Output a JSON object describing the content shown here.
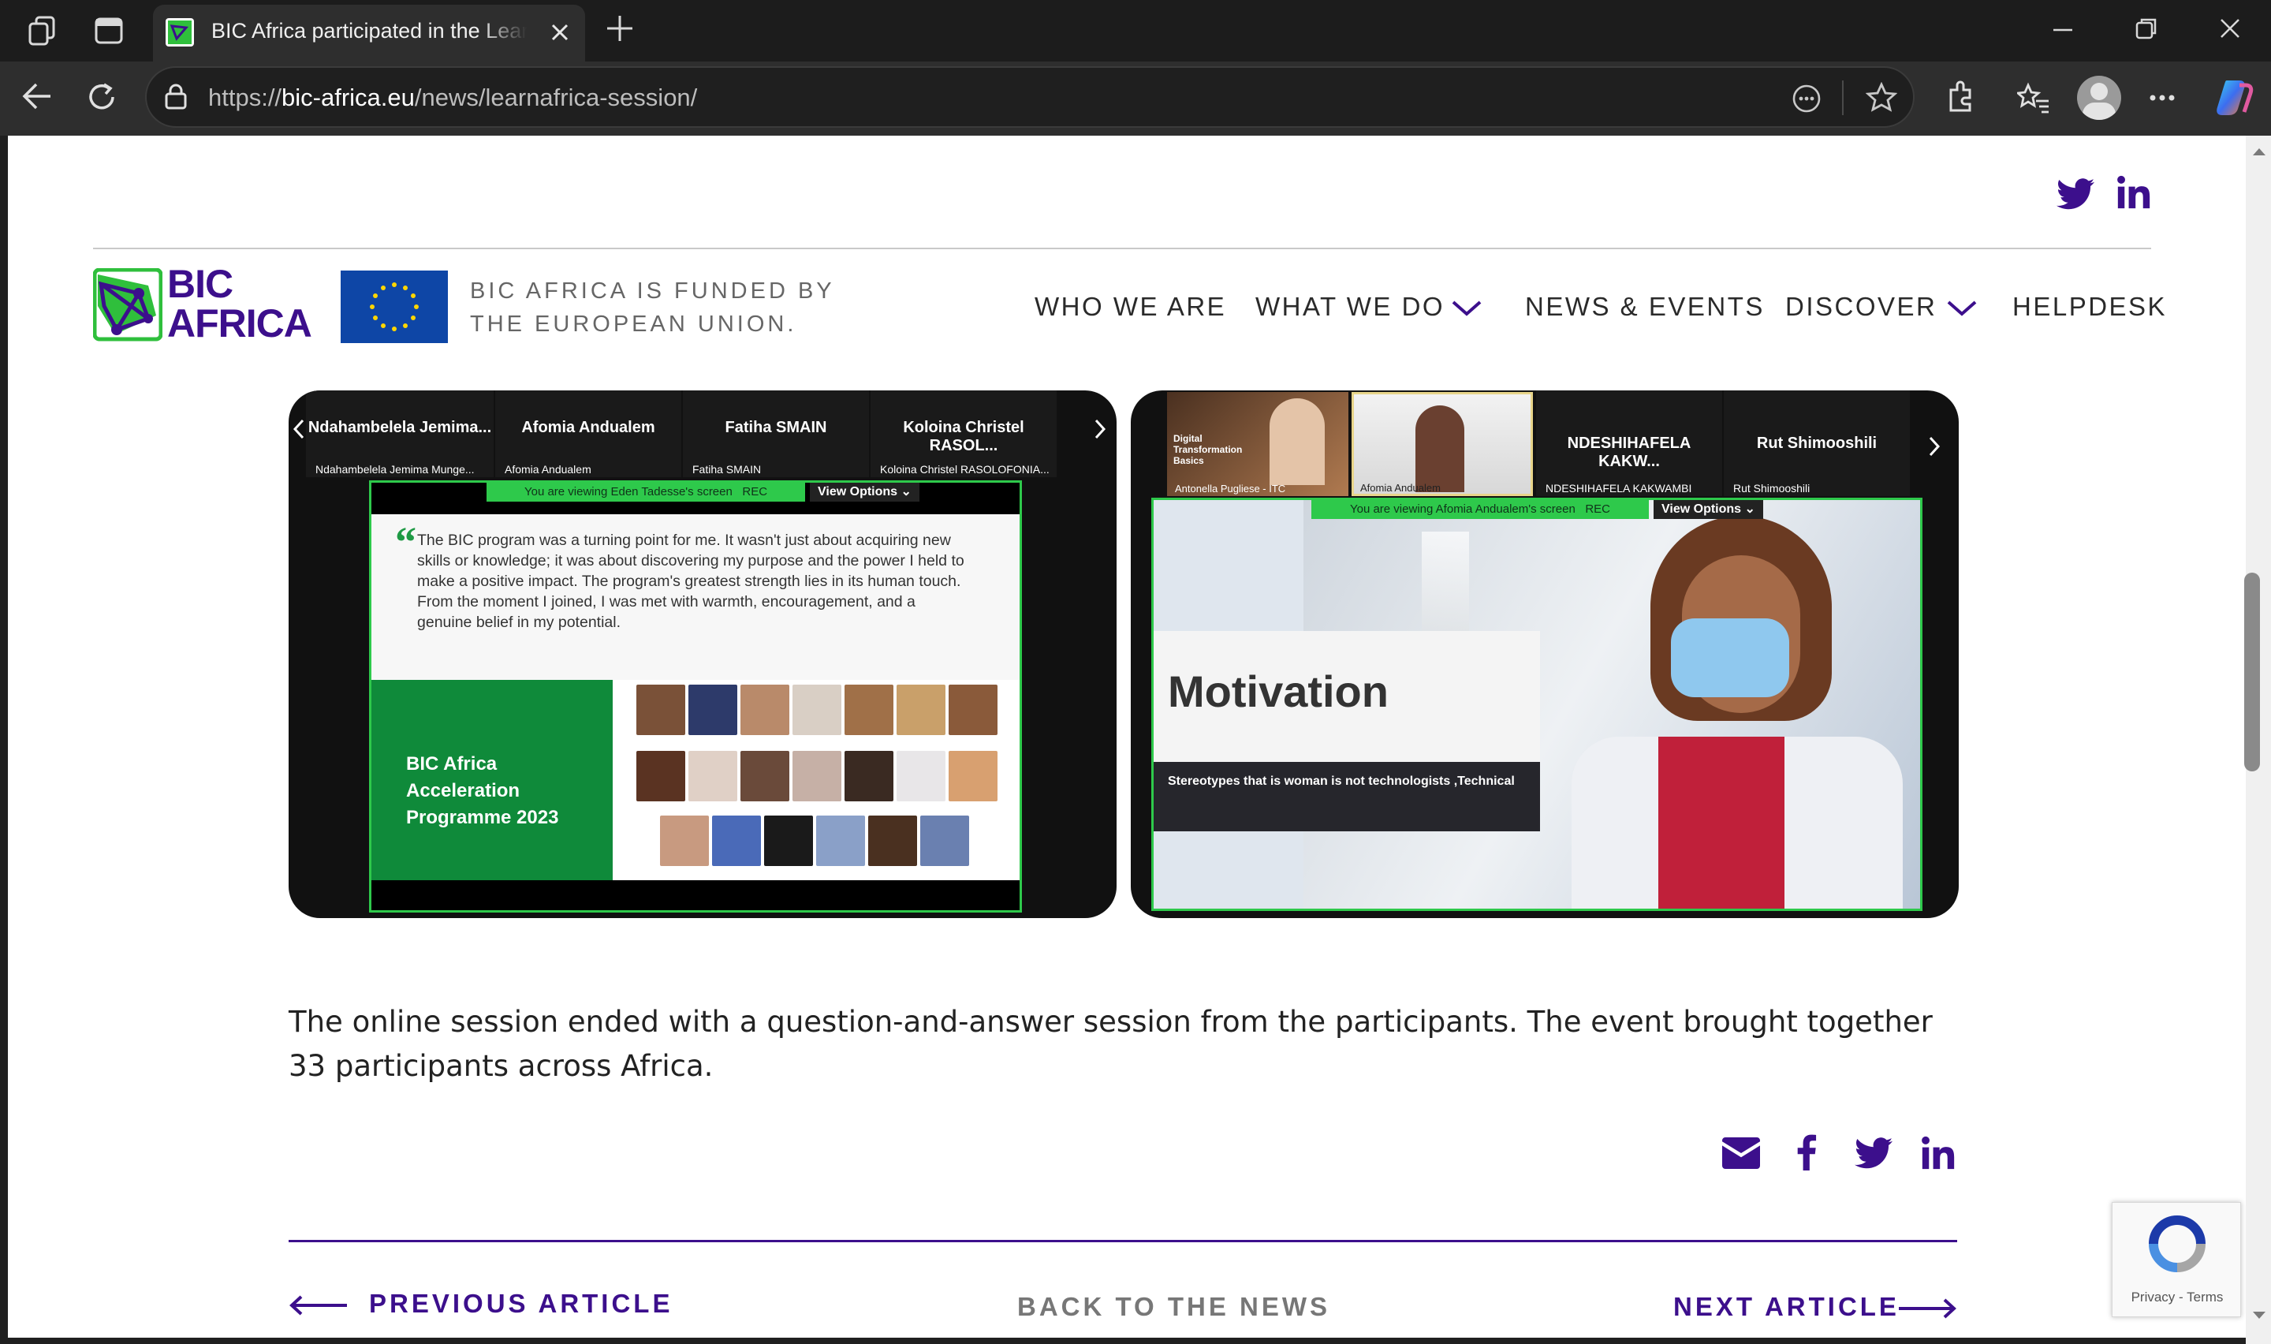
{
  "browser": {
    "tab_title": "BIC Africa participated in the LearnAfrica Session",
    "url_prefix": "https://",
    "url_host": "bic-africa.eu",
    "url_path": "/news/learnafrica-session/"
  },
  "header": {
    "logo_line1": "BIC",
    "logo_line2": "AFRICA",
    "eu_text_line1": "BIC AFRICA IS FUNDED BY",
    "eu_text_line2": "THE EUROPEAN UNION.",
    "nav": [
      "WHO WE ARE",
      "WHAT WE DO",
      "NEWS & EVENTS",
      "DISCOVER",
      "HELPDESK"
    ]
  },
  "left_zoom": {
    "participants": [
      "Ndahambelela Jemima...",
      "Afomia Andualem",
      "Fatiha SMAIN",
      "Koloina Christel RASOL..."
    ],
    "participant_subs": [
      "Ndahambelela Jemima Munge...",
      "Afomia Andualem",
      "Fatiha SMAIN",
      "Koloina Christel RASOLOFONIA..."
    ],
    "viewing": "You are viewing  Eden Tadesse's screen",
    "rec": "REC",
    "view_options": "View Options",
    "quote": "The BIC program was a turning point for me. It wasn't just about acquiring new skills or knowledge; it was about discovering my purpose and the power I held to make a positive impact. The program's greatest strength lies in its human touch. From the moment I joined, I was met with warmth, encouragement, and a genuine belief in my potential.",
    "programme": "BIC Africa Acceleration Programme 2023"
  },
  "right_zoom": {
    "participants": [
      "NDESHIHAFELA KAKW...",
      "Rut Shimooshili"
    ],
    "participant_subs": [
      "NDESHIHAFELA KAKWAMBI",
      "Rut Shimooshili"
    ],
    "video_labels": [
      "Antonella Pugliese - ITC",
      "Afomia Andualem"
    ],
    "slide_mini_title": "Digital Transformation Basics",
    "viewing": "You are viewing  Afomia Andualem's screen",
    "rec": "REC",
    "view_options": "View Options",
    "slide_title": "Motivation",
    "slide_caption": "Stereotypes that is woman is not technologists ,Technical"
  },
  "article": {
    "paragraph": "The online session ended with a question-and-answer session from the participants. The event brought together 33 participants across Africa."
  },
  "footer_nav": {
    "previous": "PREVIOUS ARTICLE",
    "back": "BACK TO THE NEWS",
    "next": "NEXT ARTICLE"
  },
  "recaptcha": {
    "privacy": "Privacy",
    "terms": "Terms"
  },
  "colors": {
    "brand_purple": "#3c0f8c",
    "brand_green": "#2fbf3c",
    "eu_blue": "#0e46a6",
    "zoom_green": "#2ec94b"
  }
}
